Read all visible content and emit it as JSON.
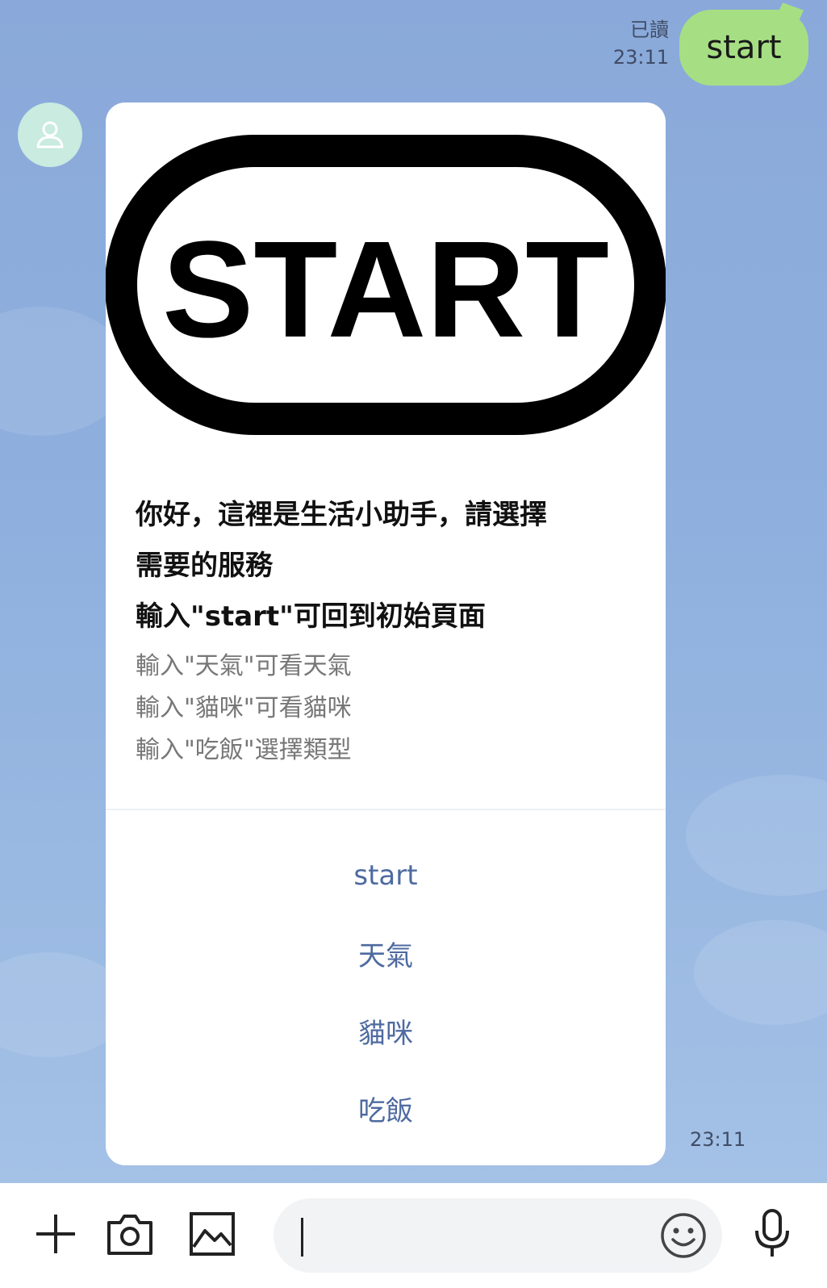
{
  "outgoing": {
    "read_label": "已讀",
    "time": "23:11",
    "text": "start"
  },
  "bot": {
    "avatar_icon": "person-outline-icon",
    "hero_text": "START",
    "intro_lines": [
      "你好，這裡是生活小助手，請選擇",
      "需要的服務",
      "輸入\"start\"可回到初始頁面"
    ],
    "hint_lines": [
      "輸入\"天氣\"可看天氣",
      "輸入\"貓咪\"可看貓咪",
      "輸入\"吃飯\"選擇類型"
    ],
    "actions": [
      "start",
      "天氣",
      "貓咪",
      "吃飯"
    ],
    "time": "23:11"
  },
  "input_bar": {
    "icons": [
      "plus-icon",
      "camera-icon",
      "image-icon",
      "emoji-icon",
      "microphone-icon"
    ],
    "message_value": "",
    "message_placeholder": ""
  },
  "colors": {
    "chat_background": "#8dabdb",
    "outgoing_bubble": "#a6df83",
    "action_text": "#4e6aa0",
    "avatar_background": "#c9ebe0"
  }
}
